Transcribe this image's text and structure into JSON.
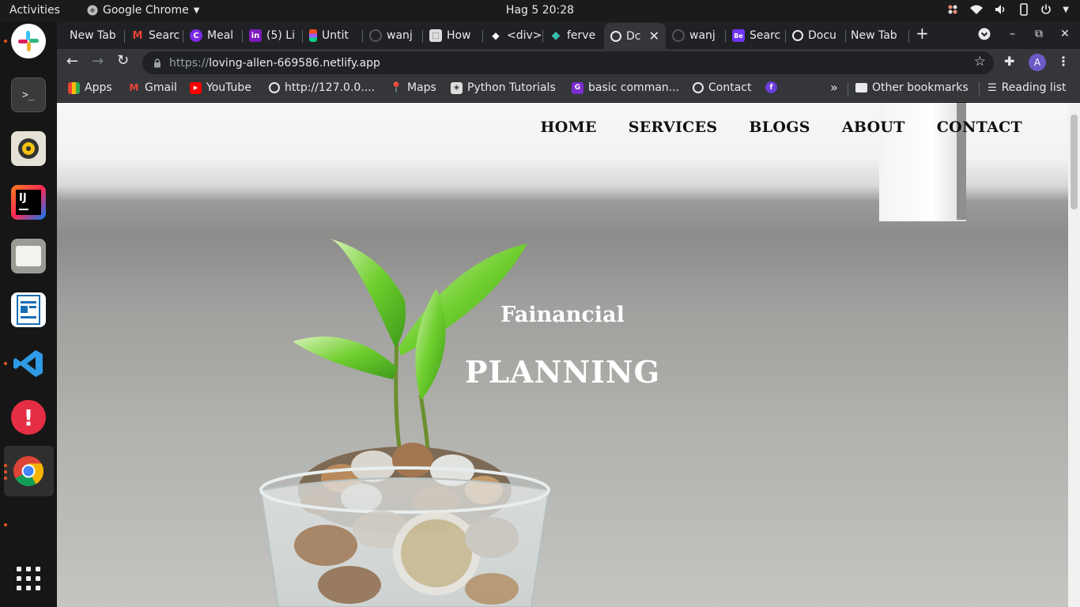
{
  "system_bar": {
    "activities": "Activities",
    "app_name": "Google Chrome",
    "clock": "Hag 5  20:28"
  },
  "dock": {
    "apps": [
      "slack",
      "terminal",
      "rhythmbox",
      "intellij",
      "files",
      "libreoffice-writer",
      "vscode",
      "update-notifier",
      "chrome",
      "show-applications"
    ]
  },
  "tabs": [
    {
      "title": "New Tab",
      "icon": "none"
    },
    {
      "title": "Searc",
      "icon": "gmail-icon"
    },
    {
      "title": "Meal",
      "icon": "canva-icon"
    },
    {
      "title": "(5) Li",
      "icon": "linkedin-icon"
    },
    {
      "title": "Untit",
      "icon": "figma-icon"
    },
    {
      "title": "wanj",
      "icon": "github-icon"
    },
    {
      "title": "How",
      "icon": "stack-icon"
    },
    {
      "title": "<div>",
      "icon": "codepen-icon"
    },
    {
      "title": "ferve",
      "icon": "netlify-icon"
    },
    {
      "title": "Dc",
      "icon": "globe-icon"
    },
    {
      "title": "wanj",
      "icon": "github-icon"
    },
    {
      "title": "Searc",
      "icon": "behance-icon"
    },
    {
      "title": "Docu",
      "icon": "globe-icon"
    },
    {
      "title": "New Tab",
      "icon": "none"
    }
  ],
  "address_bar": {
    "scheme": "https://",
    "host": "loving-allen-669586.netlify.app",
    "profile_initial": "A"
  },
  "bookmarks": [
    {
      "label": "Apps",
      "icon": "apps-grid-icon"
    },
    {
      "label": "Gmail",
      "icon": "gmail-icon"
    },
    {
      "label": "YouTube",
      "icon": "youtube-icon"
    },
    {
      "label": "http://127.0.0....",
      "icon": "globe-icon"
    },
    {
      "label": "Maps",
      "icon": "maps-icon"
    },
    {
      "label": "Python Tutorials",
      "icon": "python-icon"
    },
    {
      "label": "basic comman...",
      "icon": "bookmark-icon"
    },
    {
      "label": "Contact",
      "icon": "globe-icon"
    },
    {
      "label": "",
      "icon": "facebook-icon"
    }
  ],
  "bookmarks_right": {
    "overflow": "»",
    "other": "Other bookmarks",
    "reading": "Reading list"
  },
  "site": {
    "nav": [
      "HOME",
      "SERVICES",
      "BLOGS",
      "ABOUT",
      "CONTACT"
    ],
    "hero_subtitle": "Fainancial",
    "hero_title": "PLANNING"
  },
  "colors": {
    "chrome_dark": "#202124",
    "toolbar": "#35363a",
    "dock": "#161616",
    "accent_orange": "#e95420"
  }
}
